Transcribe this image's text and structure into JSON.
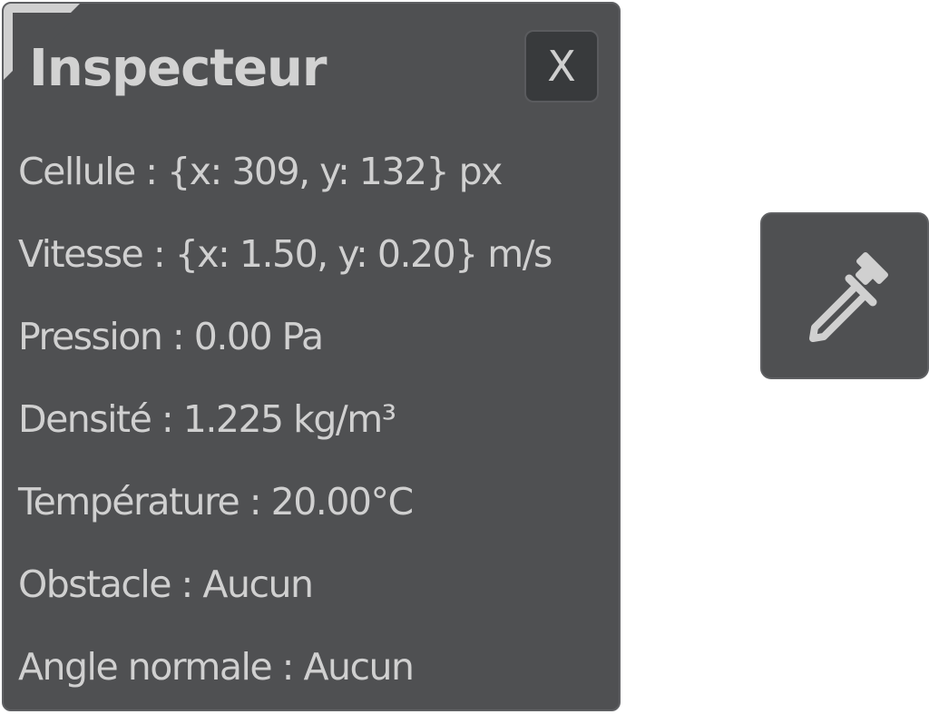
{
  "inspector": {
    "title": "Inspecteur",
    "close_label": "X",
    "rows": [
      {
        "label": "Cellule",
        "value": "{x: 309, y: 132} px"
      },
      {
        "label": "Vitesse",
        "value": "{x: 1.50, y: 0.20} m/s"
      },
      {
        "label": "Pression",
        "value": "0.00 Pa"
      },
      {
        "label": "Densité",
        "value": "1.225 kg/m³"
      },
      {
        "label": "Température",
        "value": "20.00°C"
      },
      {
        "label": "Obstacle",
        "value": "Aucun"
      },
      {
        "label": "Angle normale",
        "value": "Aucun"
      }
    ]
  },
  "tool": {
    "icon": "eyedropper-icon"
  },
  "colors": {
    "panel_bg": "#4f5052",
    "button_bg": "#383a3c",
    "text": "#d0d0d0"
  }
}
